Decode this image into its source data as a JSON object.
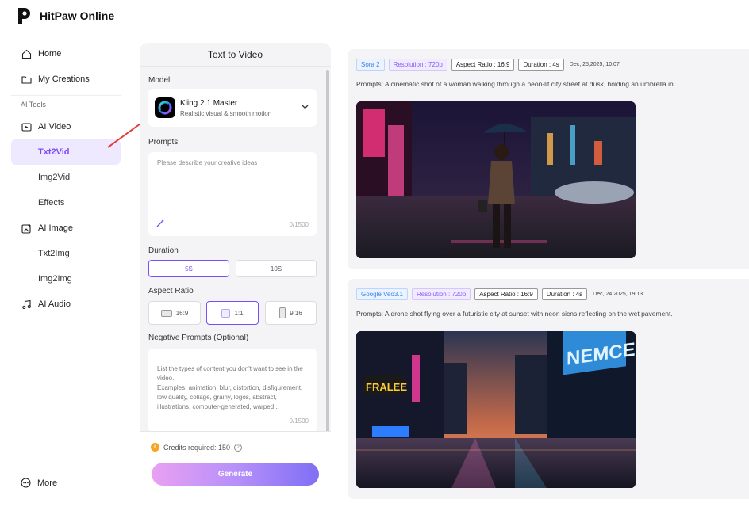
{
  "brand": {
    "name": "HitPaw Online"
  },
  "sidebar": {
    "home": "Home",
    "my_creations": "My Creations",
    "section": "AI Tools",
    "ai_video": "AI Video",
    "txt2vid": "Txt2Vid",
    "img2vid": "Img2Vid",
    "effects": "Effects",
    "ai_image": "AI Image",
    "txt2img": "Txt2Img",
    "img2img": "Img2Img",
    "ai_audio": "AI Audio",
    "more": "More"
  },
  "form": {
    "title": "Text to Video",
    "model_label": "Model",
    "model_name": "Kling 2.1 Master",
    "model_desc": "Realistic visual & smooth motion",
    "prompts_label": "Prompts",
    "prompts_placeholder": "Please describe your creative ideas",
    "prompts_counter": "0/1500",
    "duration_label": "Duration",
    "duration_options": [
      "5S",
      "10S"
    ],
    "aspect_label": "Aspect Ratio",
    "aspect_options": [
      "16:9",
      "1:1",
      "9:16"
    ],
    "negative_label": "Negative Prompts (Optional)",
    "negative_placeholder": "List the types of content you don't want to see in the video.\n Examples: animation, blur, distortion, disfigurement, low quality, collage, grainy, logos, abstract, illustrations, computer-generated, warped...",
    "negative_counter": "0/1500",
    "credits": "Credits required: 150",
    "generate": "Generate"
  },
  "results": [
    {
      "model": "Sora 2",
      "resolution": "Resolution : 720p",
      "aspect": "Aspect Ratio : 16:9",
      "duration": "Duration : 4s",
      "date": "Dec, 25,2025, 10:07",
      "prompt": "Prompts: A cinematic shot of a woman walking through a neon-lit city street at dusk, holding an umbrella in"
    },
    {
      "model": "Google Veo3.1",
      "resolution": "Resolution : 720p",
      "aspect": "Aspect Ratio : 16:9",
      "duration": "Duration : 4s",
      "date": "Dec, 24,2025, 19:13",
      "prompt": "Prompts: A drone shot flying over a futuristic city at sunset with neon sicns reflecting on the wet pavement."
    }
  ],
  "thumb_signs": {
    "fralee": "FRALEE",
    "nemce": "NEMCE"
  },
  "colors": {
    "accent": "#7b4df7",
    "annotation_arrow": "#e53935"
  }
}
